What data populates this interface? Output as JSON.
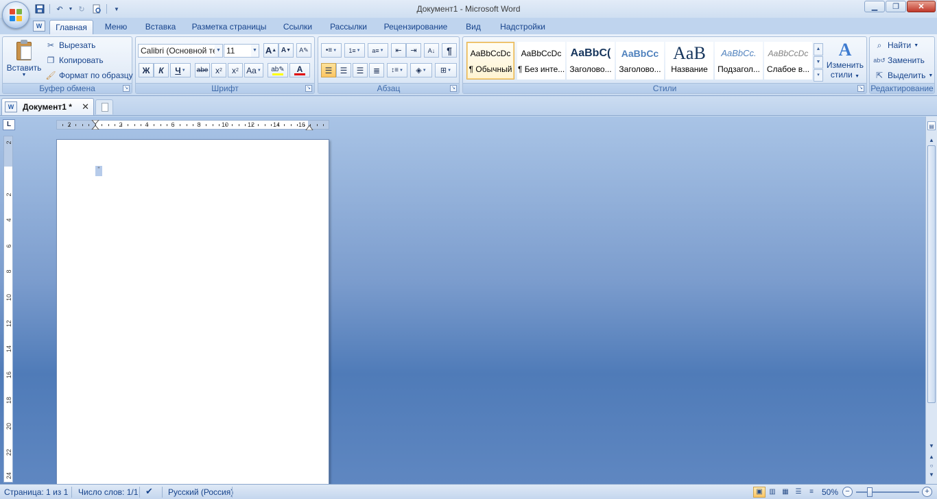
{
  "window": {
    "title": "Документ1 - Microsoft Word"
  },
  "qat": {
    "icons": [
      "save-icon",
      "undo-icon",
      "redo-icon",
      "print-preview-icon",
      "customize-icon"
    ]
  },
  "tabs": [
    {
      "label": "Главная",
      "active": true
    },
    {
      "label": "Меню"
    },
    {
      "label": "Вставка"
    },
    {
      "label": "Разметка страницы"
    },
    {
      "label": "Ссылки"
    },
    {
      "label": "Рассылки"
    },
    {
      "label": "Рецензирование"
    },
    {
      "label": "Вид"
    },
    {
      "label": "Надстройки"
    }
  ],
  "clipboard": {
    "group_label": "Буфер обмена",
    "paste": "Вставить",
    "cut": "Вырезать",
    "copy": "Копировать",
    "format_painter": "Формат по образцу"
  },
  "font": {
    "group_label": "Шрифт",
    "font_name": "Calibri (Основной текст)",
    "font_size": "11",
    "grow": "A",
    "shrink": "A",
    "bold": "Ж",
    "italic": "К",
    "underline": "Ч",
    "strike": "abe",
    "subscript": "x",
    "superscript": "x",
    "change_case": "Aa",
    "font_color": "A"
  },
  "paragraph": {
    "group_label": "Абзац",
    "pilcrow": "¶"
  },
  "styles": {
    "group_label": "Стили",
    "items": [
      {
        "sample": "AaBbCcDc",
        "name": "¶ Обычный",
        "selected": true
      },
      {
        "sample": "AaBbCcDc",
        "name": "¶ Без инте..."
      },
      {
        "sample": "AaBbC(",
        "name": "Заголово..."
      },
      {
        "sample": "AaBbCc",
        "name": "Заголово..."
      },
      {
        "sample": "AaB",
        "name": "Название"
      },
      {
        "sample": "AaBbCc.",
        "name": "Подзагол..."
      },
      {
        "sample": "AaBbCcDc",
        "name": "Слабое в..."
      }
    ],
    "change_styles_line1": "Изменить",
    "change_styles_line2": "стили"
  },
  "editing": {
    "group_label": "Редактирование",
    "find": "Найти",
    "replace": "Заменить",
    "select": "Выделить"
  },
  "document_tab": {
    "label": "Документ1  *",
    "close": "✕"
  },
  "ruler": {
    "h_ticks": [
      "2",
      "2",
      "4",
      "6",
      "8",
      "10",
      "12",
      "14",
      "16"
    ],
    "v_ticks": [
      "2",
      "2",
      "4",
      "6",
      "8",
      "10",
      "12",
      "14",
      "16",
      "18",
      "20",
      "22",
      "24"
    ]
  },
  "statusbar": {
    "page": "Страница: 1 из 1",
    "words": "Число слов: 1/1",
    "language": "Русский (Россия)",
    "zoom": "50%"
  },
  "colors": {
    "accent": "#15428b",
    "font_color_bar": "#e00000",
    "highlight_bar": "#ffff00"
  }
}
